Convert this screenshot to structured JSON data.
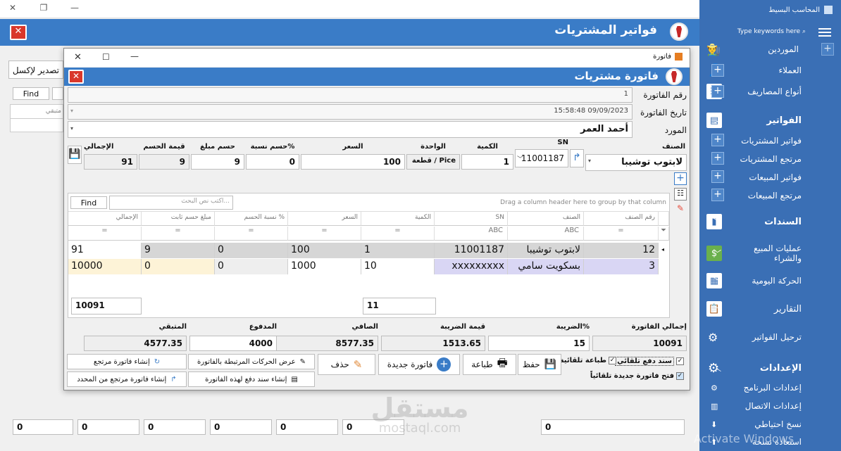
{
  "main_window": {
    "title": "فواتير المشتريات",
    "export_label": "تصدير لإكسل",
    "find_label": "Find",
    "bg_col_label": "متبقي",
    "bottom_values": [
      "0",
      "0",
      "0",
      "0",
      "0",
      "0",
      "0"
    ]
  },
  "dialog": {
    "window_title": "فاتورة",
    "header_title": "فاتورة مشتريات",
    "invoice_no_label": "رقم الفاتورة",
    "invoice_no": "1",
    "invoice_date_label": "تاريخ الفاتورة",
    "invoice_date": "15:58:48 09/09/2023",
    "supplier_label": "المورد",
    "supplier": "أحمد العمر",
    "item_entry": {
      "item_label": "الصنف",
      "item_value": "لابتوب توشيبا",
      "sn_label": "SN",
      "sn_value": "11001187",
      "qty_label": "الكمية",
      "qty_value": "1",
      "unit_label": "الواحدة",
      "unit_value": "قطعة / Pice",
      "price_label": "السعر",
      "price_value": "100",
      "disc_pct_label": "حسم نسبة%",
      "disc_pct_value": "0",
      "disc_amt_label": "حسم مبلغ",
      "disc_amt_value": "9",
      "disc_value_label": "قيمة الحسم",
      "disc_value_value": "9",
      "total_label": "الإجمالي",
      "total_value": "91"
    },
    "grid": {
      "find_label": "Find",
      "search_placeholder": "اكتب نص البحث...",
      "group_hint": "Drag a column header here to group by that column",
      "columns": [
        "رقم الصنف",
        "الصنف",
        "SN",
        "الكمية",
        "السعر",
        "نسبة الحسم %",
        "مبلغ حسم ثابت",
        "الإجمالي"
      ],
      "rows": [
        {
          "id": "12",
          "name": "لابتوب توشيبا",
          "sn": "11001187",
          "qty": "1",
          "price": "100",
          "disc_pct": "0",
          "disc_amt": "9",
          "total": "91"
        },
        {
          "id": "3",
          "name": "بسكويت سامي",
          "sn": "xxxxxxxxx",
          "qty": "10",
          "price": "1000",
          "disc_pct": "0",
          "disc_amt": "0",
          "total": "10000"
        }
      ],
      "sum_total": "10091",
      "sum_qty": "11"
    },
    "totals": {
      "invoice_total_label": "إجمالي الفاتورة",
      "invoice_total": "10091",
      "tax_pct_label": "الضريبة%",
      "tax_pct": "15",
      "tax_value_label": "قيمة الضريبة",
      "tax_value": "1513.65",
      "net_label": "الصافي",
      "net": "8577.35",
      "paid_label": "المدفوع",
      "paid": "4000",
      "remaining_label": "المتبقي",
      "remaining": "4577.35"
    },
    "actions": {
      "auto_payment": "سند دفع تلقائي",
      "auto_print": "طباعة تلقائية",
      "auto_new": "فتح فاتورة جديدة تلقائياً",
      "save": "حفظ",
      "print": "طباعة",
      "new_invoice": "فاتورة جديدة",
      "delete": "حذف",
      "show_movements": "عرض الحركات المرتبطة بالفاتورة",
      "create_payment": "إنشاء سند دفع لهذه الفاتورة",
      "create_return": "إنشاء فاتورة مرتجع",
      "create_return_selected": "إنشاء فاتورة مرتجع من المحدد"
    }
  },
  "sidebar": {
    "app_title": "المحاسب البسيط",
    "search_placeholder": "Type keywords here",
    "items": [
      {
        "label": "الموردين",
        "type": "top"
      },
      {
        "label": "العملاء",
        "type": "plus"
      },
      {
        "label": "أنواع المصاريف",
        "type": "plus"
      },
      {
        "label": "الفواتير",
        "type": "section"
      },
      {
        "label": "فواتير المشتريات",
        "type": "plus"
      },
      {
        "label": "مرتجع المشتريات",
        "type": "sub"
      },
      {
        "label": "فواتير المبيعات",
        "type": "plus"
      },
      {
        "label": "مرتجع المبيعات",
        "type": "plus"
      },
      {
        "label": "السندات",
        "type": "section"
      },
      {
        "label": "عمليات المبيع والشراء",
        "type": "section"
      },
      {
        "label": "الحركة اليومية",
        "type": "section"
      },
      {
        "label": "التقارير",
        "type": "section"
      },
      {
        "label": "ترحيل الفواتير",
        "type": "section"
      },
      {
        "label": "الإعدادات",
        "type": "section"
      },
      {
        "label": "إعدادات البرنامج",
        "type": "sub"
      },
      {
        "label": "إعدادات الاتصال",
        "type": "sub"
      },
      {
        "label": "نسخ احتياطي",
        "type": "sub"
      },
      {
        "label": "استعادة نسخة",
        "type": "sub"
      }
    ],
    "watermark": "Activate Windows"
  },
  "watermark": {
    "brand": "مستقل",
    "url": "mostaql.com"
  },
  "colors": {
    "accent": "#3a7cc7",
    "sidebar": "#3a6fb5",
    "danger": "#d9372b"
  }
}
